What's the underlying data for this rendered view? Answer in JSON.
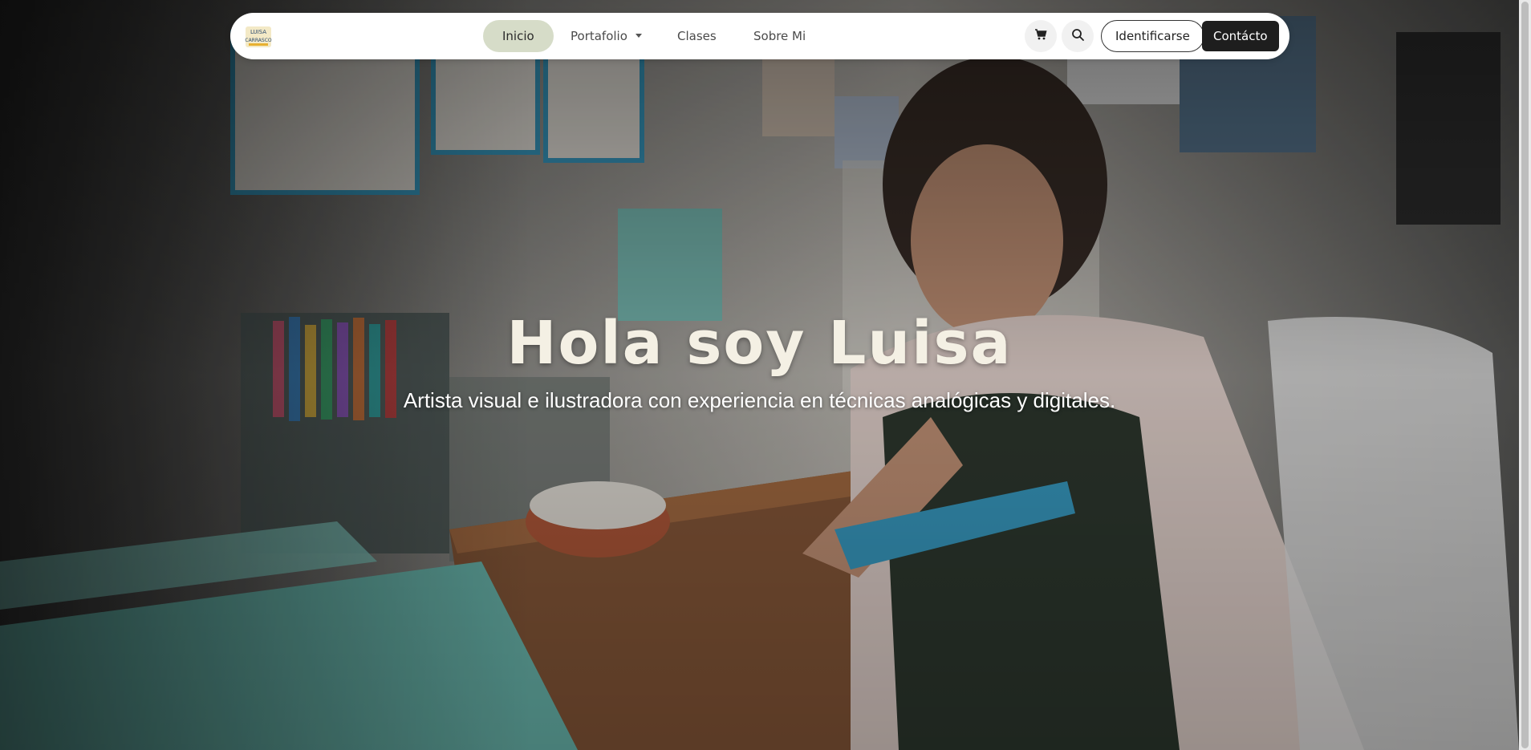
{
  "navbar": {
    "logo_label": "LUISA CARRASCO",
    "items": [
      {
        "label": "Inicio",
        "active": true
      },
      {
        "label": "Portafolio",
        "has_dropdown": true
      },
      {
        "label": "Clases"
      },
      {
        "label": "Sobre Mi"
      }
    ],
    "cart_icon": "cart-icon",
    "search_icon": "search-icon",
    "login_label": "Identificarse",
    "contact_label": "Contácto"
  },
  "hero": {
    "title": "Hola soy Luisa",
    "subtitle": "Artista visual e ilustradora con experiencia en técnicas analógicas y digitales."
  },
  "colors": {
    "active_nav_bg": "#d6dcc8",
    "contact_button_bg": "#1e1e1e",
    "hero_title": "#f4f0e4"
  }
}
